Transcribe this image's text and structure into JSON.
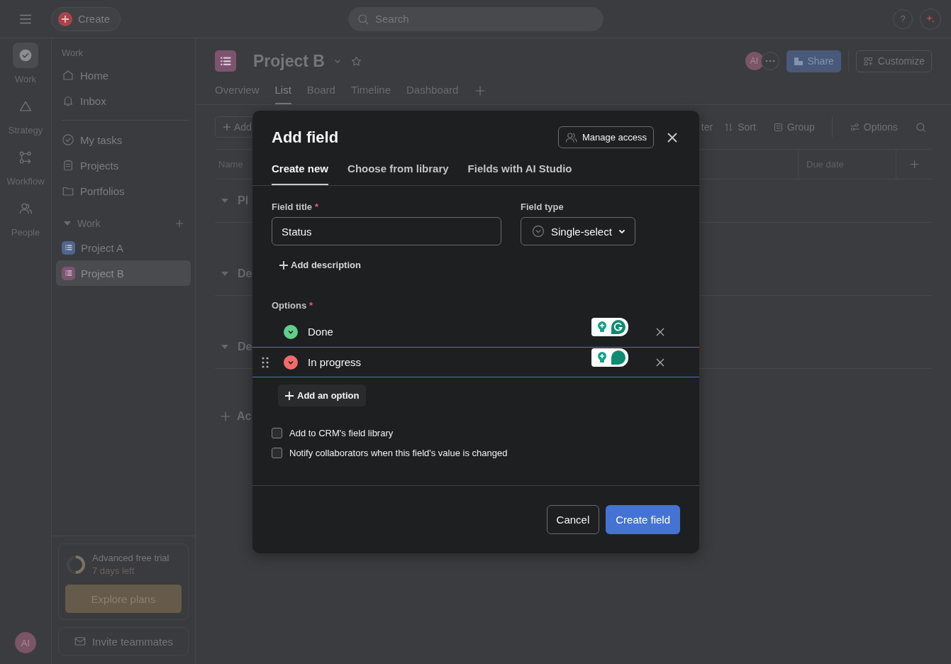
{
  "topbar": {
    "create": "Create",
    "search_placeholder": "Search",
    "help": "?"
  },
  "rail": [
    {
      "label": "Work",
      "selected": true
    },
    {
      "label": "Strategy",
      "selected": false
    },
    {
      "label": "Workflow",
      "selected": false
    },
    {
      "label": "People",
      "selected": false
    }
  ],
  "rail_avatar": "AI",
  "sidebar": {
    "heading": "Work",
    "nav": [
      {
        "label": "Home"
      },
      {
        "label": "Inbox"
      }
    ],
    "nav2": [
      {
        "label": "My tasks"
      },
      {
        "label": "Projects"
      },
      {
        "label": "Portfolios"
      }
    ],
    "section": {
      "label": "Work",
      "expanded": true
    },
    "projects": [
      {
        "name": "Project A",
        "color": "#4f6690",
        "selected": false
      },
      {
        "name": "Project B",
        "color": "#7c5470",
        "selected": true
      }
    ],
    "trial": {
      "title": "Advanced free trial",
      "subtitle": "7 days left",
      "level": 0.5,
      "button": "Explore plans"
    },
    "invite": "Invite teammates"
  },
  "project": {
    "title": "Project B",
    "avatar": "AI",
    "share": "Share",
    "customize": "Customize",
    "tabs": [
      {
        "label": "Overview",
        "selected": false
      },
      {
        "label": "List",
        "selected": true
      },
      {
        "label": "Board",
        "selected": false
      },
      {
        "label": "Timeline",
        "selected": false
      },
      {
        "label": "Dashboard",
        "selected": false
      }
    ]
  },
  "toolbar": {
    "add": "Add",
    "filter": "ter",
    "sort": "Sort",
    "group": "Group",
    "options": "Options"
  },
  "table": {
    "columns": [
      "Name",
      "Due date"
    ],
    "sections": [
      "Pl",
      "De",
      "De"
    ],
    "add_row": "Ac"
  },
  "modal": {
    "title": "Add field",
    "manage_access": "Manage access",
    "tabs": [
      {
        "label": "Create new",
        "selected": true
      },
      {
        "label": "Choose from library",
        "selected": false
      },
      {
        "label": "Fields with AI Studio",
        "selected": false
      }
    ],
    "field_title_label": "Field title",
    "field_title_required": "*",
    "field_title_value": "Status",
    "field_type_label": "Field type",
    "field_type_value": "Single-select",
    "add_description": "Add description",
    "options_label": "Options",
    "options_required": "*",
    "options": [
      {
        "label": "Done",
        "color": "#5fcf8c",
        "focused": false
      },
      {
        "label": "In progress",
        "color": "#f26b6b",
        "focused": true
      }
    ],
    "add_option": "Add an option",
    "checkboxes": [
      {
        "label": "Add to CRM's field library",
        "checked": false
      },
      {
        "label": "Notify collaborators when this field's value is changed",
        "checked": false
      }
    ],
    "cancel": "Cancel",
    "create": "Create field"
  }
}
